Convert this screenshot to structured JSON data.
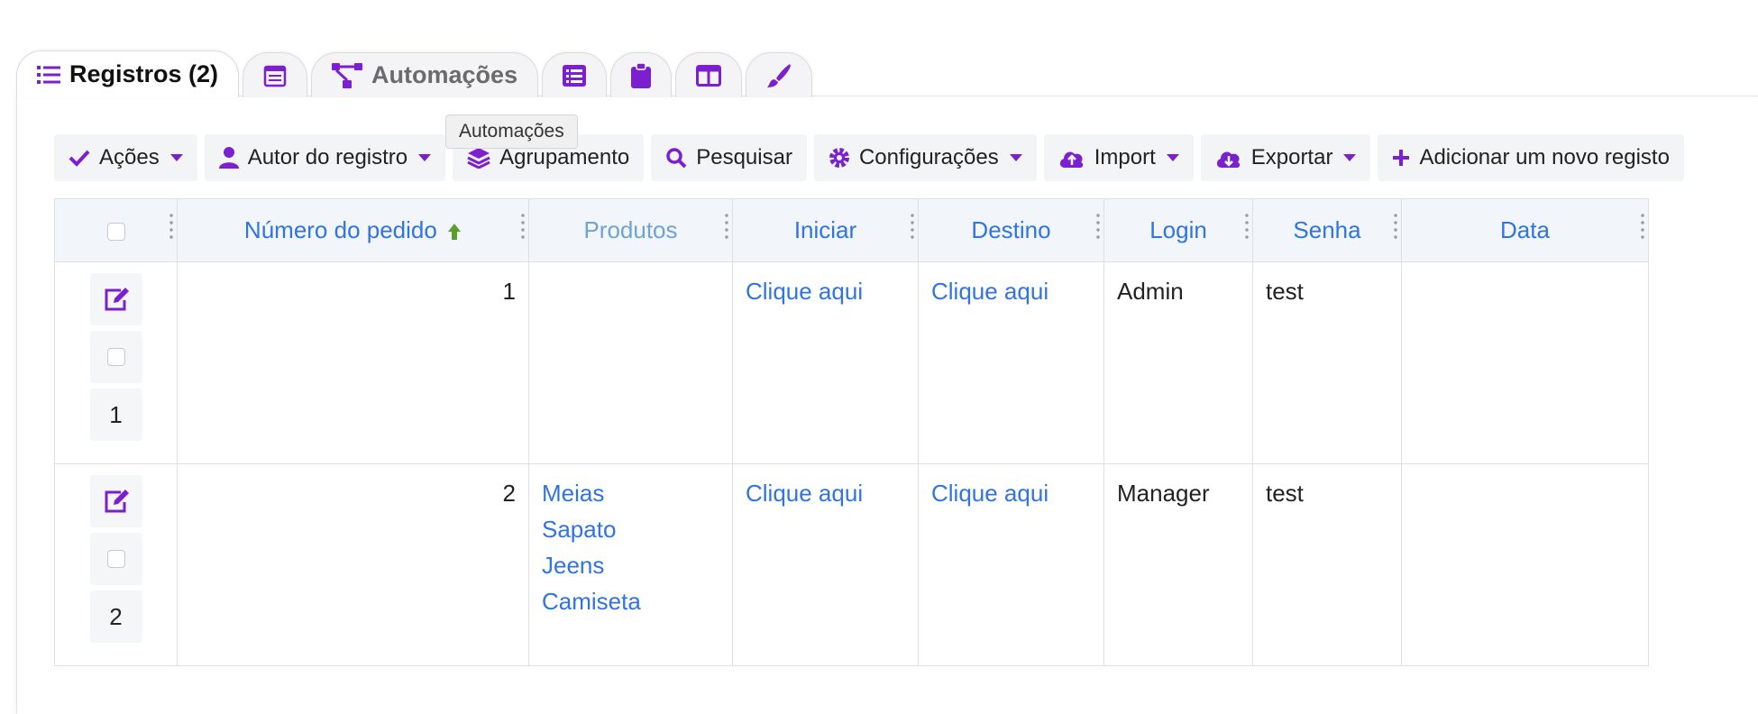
{
  "tabs": [
    {
      "label": "Registros (2)",
      "icon": "list-icon",
      "active": true
    },
    {
      "label": "",
      "icon": "calendar-icon"
    },
    {
      "label": "Automações",
      "icon": "sitemap-icon"
    },
    {
      "label": "",
      "icon": "table-list-icon"
    },
    {
      "label": "",
      "icon": "clipboard-icon"
    },
    {
      "label": "",
      "icon": "columns-icon"
    },
    {
      "label": "",
      "icon": "paint-brush-icon"
    }
  ],
  "tooltip": "Automações",
  "toolbar": {
    "acoes": "Ações",
    "autor": "Autor do registro",
    "agrupamento": "Agrupamento",
    "pesquisar": "Pesquisar",
    "configuracoes": "Configurações",
    "import": "Import",
    "exportar": "Exportar",
    "adicionar": "Adicionar um novo registo"
  },
  "table": {
    "columns": [
      "Número do pedido",
      "Produtos",
      "Iniciar",
      "Destino",
      "Login",
      "Senha",
      "Data"
    ],
    "rows": [
      {
        "index": "1",
        "numero": "1",
        "produtos": [],
        "iniciar": "Clique aqui",
        "destino": "Clique aqui",
        "login": "Admin",
        "senha": "test",
        "data": ""
      },
      {
        "index": "2",
        "numero": "2",
        "produtos": [
          "Meias",
          "Sapato",
          "Jeens",
          "Camiseta"
        ],
        "iniciar": "Clique aqui",
        "destino": "Clique aqui",
        "login": "Manager",
        "senha": "test",
        "data": ""
      }
    ]
  },
  "colors": {
    "accent": "#7b1fd0",
    "link": "#2f74e0",
    "header_bg": "#f2f6fb",
    "sort_arrow": "#5aa02c"
  }
}
